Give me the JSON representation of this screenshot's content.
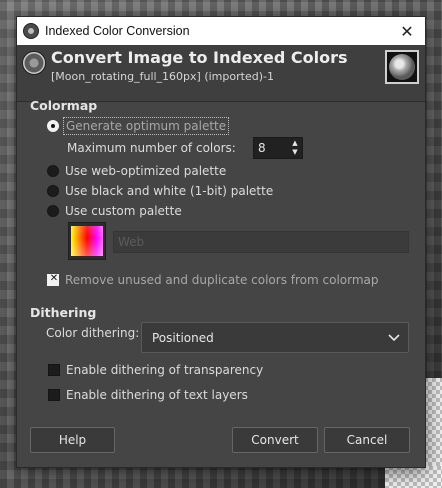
{
  "window": {
    "title": "Indexed Color Conversion",
    "close_glyph": "✕"
  },
  "header": {
    "title": "Convert Image to Indexed Colors",
    "subtitle": "[Moon_rotating_full_160px] (imported)-1",
    "icon": "gimp-wilber-icon",
    "thumbnail": "moon-image-thumbnail"
  },
  "colormap": {
    "section_title": "Colormap",
    "options": [
      {
        "label": "Generate optimum palette",
        "selected": true
      },
      {
        "label": "Use web-optimized palette",
        "selected": false
      },
      {
        "label": "Use black and white (1-bit) palette",
        "selected": false
      },
      {
        "label": "Use custom palette",
        "selected": false
      }
    ],
    "max_colors_label": "Maximum number of colors:",
    "max_colors_value": "8",
    "custom_palette_placeholder": "Web",
    "remove_unused_label": "Remove unused and duplicate colors from colormap",
    "remove_unused_checked": true
  },
  "dithering": {
    "section_title": "Dithering",
    "color_dithering_label": "Color dithering:",
    "color_dithering_value": "Positioned",
    "transparency_label": "Enable dithering of transparency",
    "transparency_checked": false,
    "text_layers_label": "Enable dithering of text layers",
    "text_layers_checked": false
  },
  "buttons": {
    "help": "Help",
    "convert": "Convert",
    "cancel": "Cancel"
  },
  "colors": {
    "dialog_bg": "#454545",
    "header_bg": "#3f3f3f",
    "titlebar_bg": "#ffffff",
    "text": "#dcdcdc"
  }
}
